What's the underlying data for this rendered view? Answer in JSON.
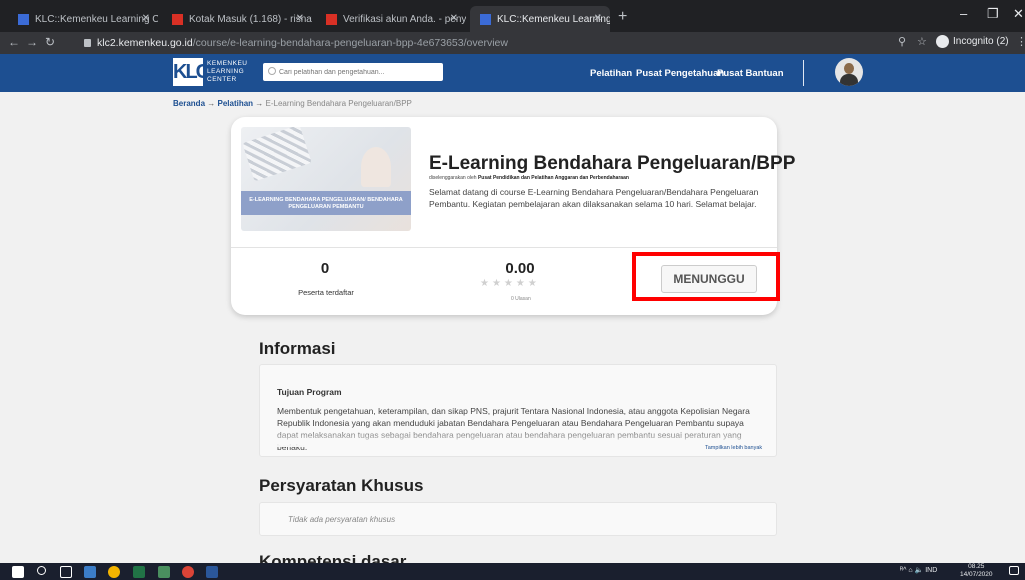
{
  "browser": {
    "tabs": [
      {
        "title": "KLC::Kemenkeu Learning Center",
        "active": false
      },
      {
        "title": "Kotak Masuk (1.168) - risnawati",
        "active": false
      },
      {
        "title": "Verifikasi akun Anda. - penyeleng",
        "active": false
      },
      {
        "title": "KLC::Kemenkeu Learning Center",
        "active": true
      }
    ],
    "new_tab": "+",
    "url_domain": "klc2.kemenkeu.go.id",
    "url_path": "/course/e-learning-bendahara-pengeluaran-bpp-4e673653/overview",
    "incognito_label": "Incognito (2)"
  },
  "site": {
    "logo_mark": "KLC",
    "logo_words": [
      "KEMENKEU",
      "LEARNING",
      "CENTER"
    ],
    "search_placeholder": "Cari pelatihan dan pengetahuan...",
    "nav": [
      "Pelatihan",
      "Pusat Pengetahuan",
      "Pusat Bantuan"
    ]
  },
  "breadcrumb": {
    "home": "Beranda",
    "arrow": "→",
    "section": "Pelatihan",
    "current": "E-Learning Bendahara Pengeluaran/BPP"
  },
  "course": {
    "thumb_text": "E-LEARNING BENDAHARA PENGELUARAN/ BENDAHARA PENGELUARAN PEMBANTU",
    "title": "E-Learning Bendahara Pengeluaran/BPP",
    "organizer_prefix": "diselenggarakan oleh",
    "organizer": "Pusat Pendidikan dan Pelatihan Anggaran dan Perbendaharaan",
    "description": "Selamat datang di course E-Learning Bendahara Pengeluaran/Bendahara Pengeluaran Pembantu. Kegiatan pembelajaran akan dilaksanakan selama 10 hari. Selamat belajar.",
    "participants": "0",
    "participants_label": "Peserta terdaftar",
    "rating": "0.00",
    "rating_stars": 0,
    "stars": "★★★★★",
    "reviews": "0 Ulasan",
    "status_button": "MENUNGGU"
  },
  "info": {
    "heading": "Informasi",
    "subtitle": "Tujuan Program",
    "text": "Membentuk pengetahuan, keterampilan, dan sikap PNS, prajurit Tentara Nasional Indonesia, atau anggota Kepolisian Negara Republik Indonesia yang akan menduduki jabatan Bendahara Pengeluaran atau Bendahara Pengeluaran Pembantu supaya dapat melaksanakan tugas sebagai bendahara pengeluaran atau bendahara pengeluaran pembantu sesuai peraturan yang berlaku.",
    "show_more": "Tampilkan lebih banyak"
  },
  "requirements": {
    "heading": "Persyaratan Khusus",
    "text": "Tidak ada persyaratan khusus"
  },
  "next_section": "Kompetensi dasar",
  "taskbar": {
    "tray": "ᴿ^ ⌂ 🔈 IND",
    "time": "08.25",
    "date": "14/07/2020"
  },
  "colors": {
    "header_blue": "#1d4f91",
    "highlight": "#ff0000"
  }
}
